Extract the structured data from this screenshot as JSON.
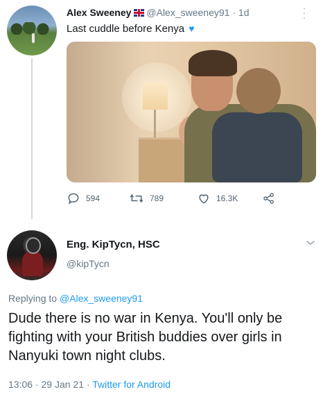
{
  "tweet1": {
    "author_name": "Alex Sweeney",
    "handle": "@Alex_sweeney91",
    "separator": "·",
    "age": "1d",
    "text": "Last cuddle before Kenya",
    "emoji": "♥",
    "icons": {
      "flag": "uk-flag-icon",
      "more": "more-options-icon",
      "heart_emoji": "blue-heart-icon"
    },
    "actions": {
      "replies": "594",
      "retweets": "789",
      "likes": "16.3K"
    }
  },
  "tweet2": {
    "author_name": "Eng. KipTycn, HSC",
    "handle": "@kipTycn",
    "reply_prefix": "Replying to ",
    "reply_mention": "@Alex_sweeney91",
    "text": "Dude there is no war in Kenya. You'll only be fighting with your British buddies over girls in Nanyuki town night clubs.",
    "time": "13:06",
    "date": "29 Jan 21",
    "separator": "·",
    "client": "Twitter for Android"
  },
  "colors": {
    "link": "#1d9bf0",
    "muted": "#657786",
    "text": "#14171a"
  }
}
